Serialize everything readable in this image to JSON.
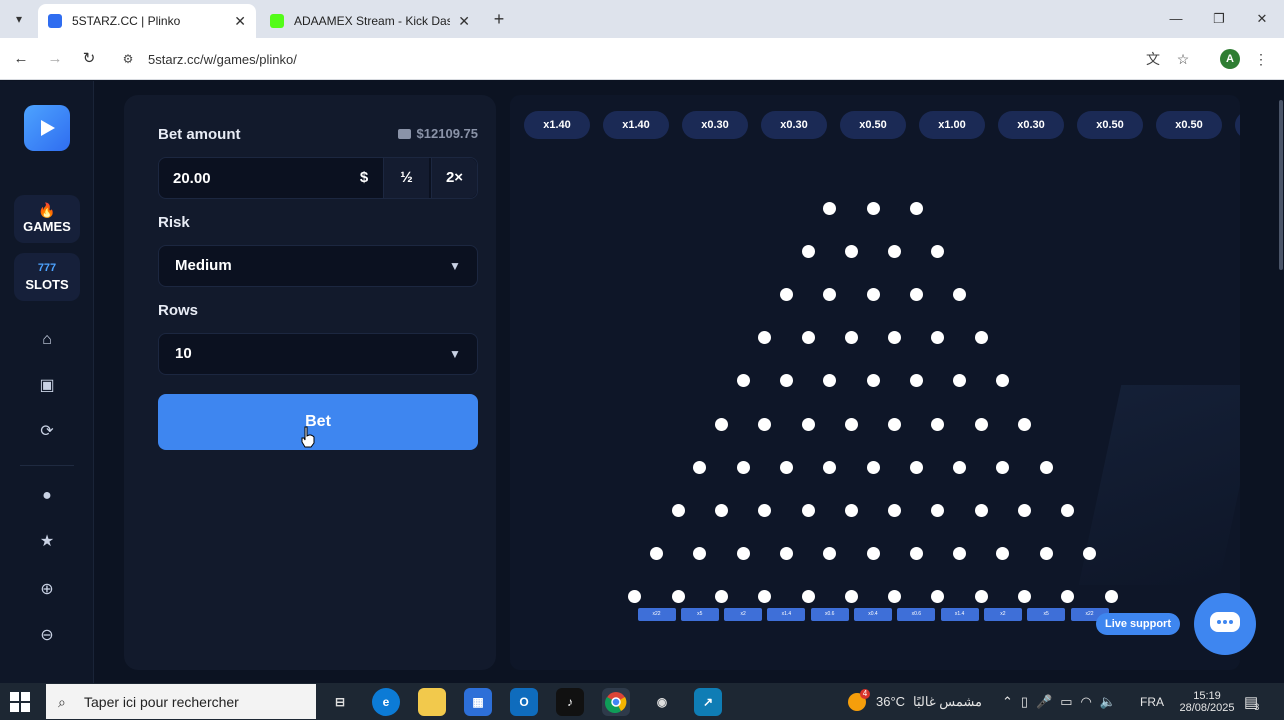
{
  "browser": {
    "tabs": [
      {
        "title": "5STARZ.CC | Plinko",
        "active": true
      },
      {
        "title": "ADAAMEX Stream - Kick Dashb",
        "active": false
      }
    ],
    "url": "5starz.cc/w/games/plinko/",
    "profile_initial": "A"
  },
  "sidebar": {
    "games_label": "GAMES",
    "slots_label": "SLOTS"
  },
  "controls": {
    "bet_amount_label": "Bet amount",
    "balance": "$12109.75",
    "bet_value": "20.00",
    "currency_symbol": "$",
    "half_label": "½",
    "double_label": "2×",
    "risk_label": "Risk",
    "risk_value": "Medium",
    "rows_label": "Rows",
    "rows_value": "10",
    "bet_button_label": "Bet"
  },
  "game": {
    "multipliers": [
      "x1.40",
      "x1.40",
      "x0.30",
      "x0.30",
      "x0.50",
      "x1.00",
      "x0.30",
      "x0.50",
      "x0.50"
    ],
    "buckets": [
      "x22",
      "x5",
      "x2",
      "x1.4",
      "x0.6",
      "x0.4",
      "x0.6",
      "x1.4",
      "x2",
      "x5",
      "x22"
    ],
    "peg_rows": 10
  },
  "support": {
    "live_support_label": "Live support"
  },
  "taskbar": {
    "search_placeholder": "Taper ici pour rechercher",
    "temperature": "36°C",
    "weather_badge": "4",
    "weather_text": "مشمس غالبًا",
    "language": "FRA",
    "time": "15:19",
    "date": "28/08/2025",
    "notification_count": "3"
  }
}
